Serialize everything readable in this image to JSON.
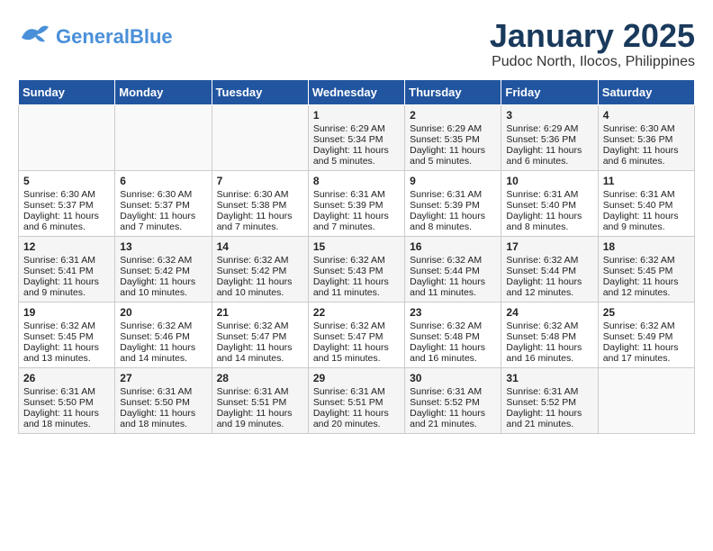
{
  "header": {
    "logo_general": "General",
    "logo_blue": "Blue",
    "title": "January 2025",
    "subtitle": "Pudoc North, Ilocos, Philippines"
  },
  "days_of_week": [
    "Sunday",
    "Monday",
    "Tuesday",
    "Wednesday",
    "Thursday",
    "Friday",
    "Saturday"
  ],
  "weeks": [
    [
      {
        "day": "",
        "sunrise": "",
        "sunset": "",
        "daylight": ""
      },
      {
        "day": "",
        "sunrise": "",
        "sunset": "",
        "daylight": ""
      },
      {
        "day": "",
        "sunrise": "",
        "sunset": "",
        "daylight": ""
      },
      {
        "day": "1",
        "sunrise": "Sunrise: 6:29 AM",
        "sunset": "Sunset: 5:34 PM",
        "daylight": "Daylight: 11 hours and 5 minutes."
      },
      {
        "day": "2",
        "sunrise": "Sunrise: 6:29 AM",
        "sunset": "Sunset: 5:35 PM",
        "daylight": "Daylight: 11 hours and 5 minutes."
      },
      {
        "day": "3",
        "sunrise": "Sunrise: 6:29 AM",
        "sunset": "Sunset: 5:36 PM",
        "daylight": "Daylight: 11 hours and 6 minutes."
      },
      {
        "day": "4",
        "sunrise": "Sunrise: 6:30 AM",
        "sunset": "Sunset: 5:36 PM",
        "daylight": "Daylight: 11 hours and 6 minutes."
      }
    ],
    [
      {
        "day": "5",
        "sunrise": "Sunrise: 6:30 AM",
        "sunset": "Sunset: 5:37 PM",
        "daylight": "Daylight: 11 hours and 6 minutes."
      },
      {
        "day": "6",
        "sunrise": "Sunrise: 6:30 AM",
        "sunset": "Sunset: 5:37 PM",
        "daylight": "Daylight: 11 hours and 7 minutes."
      },
      {
        "day": "7",
        "sunrise": "Sunrise: 6:30 AM",
        "sunset": "Sunset: 5:38 PM",
        "daylight": "Daylight: 11 hours and 7 minutes."
      },
      {
        "day": "8",
        "sunrise": "Sunrise: 6:31 AM",
        "sunset": "Sunset: 5:39 PM",
        "daylight": "Daylight: 11 hours and 7 minutes."
      },
      {
        "day": "9",
        "sunrise": "Sunrise: 6:31 AM",
        "sunset": "Sunset: 5:39 PM",
        "daylight": "Daylight: 11 hours and 8 minutes."
      },
      {
        "day": "10",
        "sunrise": "Sunrise: 6:31 AM",
        "sunset": "Sunset: 5:40 PM",
        "daylight": "Daylight: 11 hours and 8 minutes."
      },
      {
        "day": "11",
        "sunrise": "Sunrise: 6:31 AM",
        "sunset": "Sunset: 5:40 PM",
        "daylight": "Daylight: 11 hours and 9 minutes."
      }
    ],
    [
      {
        "day": "12",
        "sunrise": "Sunrise: 6:31 AM",
        "sunset": "Sunset: 5:41 PM",
        "daylight": "Daylight: 11 hours and 9 minutes."
      },
      {
        "day": "13",
        "sunrise": "Sunrise: 6:32 AM",
        "sunset": "Sunset: 5:42 PM",
        "daylight": "Daylight: 11 hours and 10 minutes."
      },
      {
        "day": "14",
        "sunrise": "Sunrise: 6:32 AM",
        "sunset": "Sunset: 5:42 PM",
        "daylight": "Daylight: 11 hours and 10 minutes."
      },
      {
        "day": "15",
        "sunrise": "Sunrise: 6:32 AM",
        "sunset": "Sunset: 5:43 PM",
        "daylight": "Daylight: 11 hours and 11 minutes."
      },
      {
        "day": "16",
        "sunrise": "Sunrise: 6:32 AM",
        "sunset": "Sunset: 5:44 PM",
        "daylight": "Daylight: 11 hours and 11 minutes."
      },
      {
        "day": "17",
        "sunrise": "Sunrise: 6:32 AM",
        "sunset": "Sunset: 5:44 PM",
        "daylight": "Daylight: 11 hours and 12 minutes."
      },
      {
        "day": "18",
        "sunrise": "Sunrise: 6:32 AM",
        "sunset": "Sunset: 5:45 PM",
        "daylight": "Daylight: 11 hours and 12 minutes."
      }
    ],
    [
      {
        "day": "19",
        "sunrise": "Sunrise: 6:32 AM",
        "sunset": "Sunset: 5:45 PM",
        "daylight": "Daylight: 11 hours and 13 minutes."
      },
      {
        "day": "20",
        "sunrise": "Sunrise: 6:32 AM",
        "sunset": "Sunset: 5:46 PM",
        "daylight": "Daylight: 11 hours and 14 minutes."
      },
      {
        "day": "21",
        "sunrise": "Sunrise: 6:32 AM",
        "sunset": "Sunset: 5:47 PM",
        "daylight": "Daylight: 11 hours and 14 minutes."
      },
      {
        "day": "22",
        "sunrise": "Sunrise: 6:32 AM",
        "sunset": "Sunset: 5:47 PM",
        "daylight": "Daylight: 11 hours and 15 minutes."
      },
      {
        "day": "23",
        "sunrise": "Sunrise: 6:32 AM",
        "sunset": "Sunset: 5:48 PM",
        "daylight": "Daylight: 11 hours and 16 minutes."
      },
      {
        "day": "24",
        "sunrise": "Sunrise: 6:32 AM",
        "sunset": "Sunset: 5:48 PM",
        "daylight": "Daylight: 11 hours and 16 minutes."
      },
      {
        "day": "25",
        "sunrise": "Sunrise: 6:32 AM",
        "sunset": "Sunset: 5:49 PM",
        "daylight": "Daylight: 11 hours and 17 minutes."
      }
    ],
    [
      {
        "day": "26",
        "sunrise": "Sunrise: 6:31 AM",
        "sunset": "Sunset: 5:50 PM",
        "daylight": "Daylight: 11 hours and 18 minutes."
      },
      {
        "day": "27",
        "sunrise": "Sunrise: 6:31 AM",
        "sunset": "Sunset: 5:50 PM",
        "daylight": "Daylight: 11 hours and 18 minutes."
      },
      {
        "day": "28",
        "sunrise": "Sunrise: 6:31 AM",
        "sunset": "Sunset: 5:51 PM",
        "daylight": "Daylight: 11 hours and 19 minutes."
      },
      {
        "day": "29",
        "sunrise": "Sunrise: 6:31 AM",
        "sunset": "Sunset: 5:51 PM",
        "daylight": "Daylight: 11 hours and 20 minutes."
      },
      {
        "day": "30",
        "sunrise": "Sunrise: 6:31 AM",
        "sunset": "Sunset: 5:52 PM",
        "daylight": "Daylight: 11 hours and 21 minutes."
      },
      {
        "day": "31",
        "sunrise": "Sunrise: 6:31 AM",
        "sunset": "Sunset: 5:52 PM",
        "daylight": "Daylight: 11 hours and 21 minutes."
      },
      {
        "day": "",
        "sunrise": "",
        "sunset": "",
        "daylight": ""
      }
    ]
  ]
}
